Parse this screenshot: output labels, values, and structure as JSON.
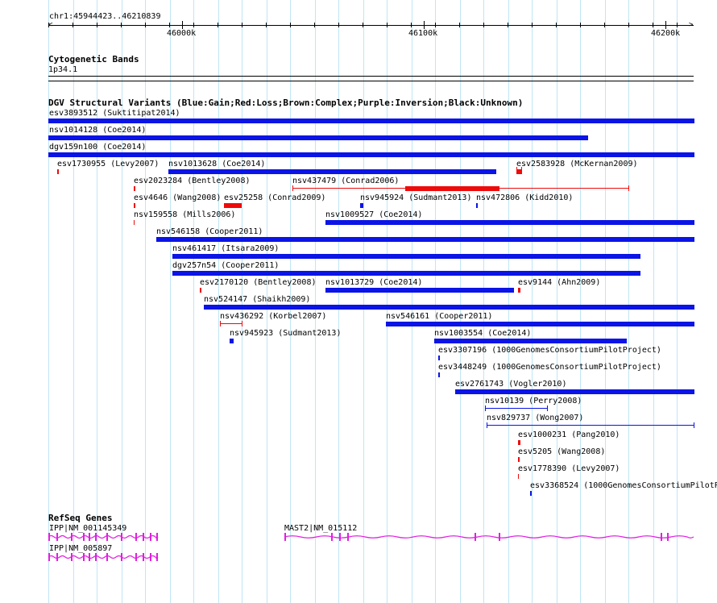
{
  "colors": {
    "gain": "#0b14e6",
    "loss": "#ee0b0b",
    "gene": "#e020e0",
    "grid": "#bfe6f5"
  },
  "ruler": {
    "locus": "chr1:45944423..46210839",
    "labels": [
      "46000k",
      "46100k",
      "46200k"
    ]
  },
  "cytoband": {
    "title": "Cytogenetic Bands",
    "band": "1p34.1"
  },
  "dgv": {
    "title": "DGV Structural Variants (Blue:Gain;Red:Loss;Brown:Complex;Purple:Inversion;Black:Unknown)",
    "features": [
      {
        "label": "esv3893512 (Suktitipat2014)",
        "type": "gain"
      },
      {
        "label": "nsv1014128 (Coe2014)",
        "type": "gain"
      },
      {
        "label": "dgv159n100 (Coe2014)",
        "type": "gain"
      },
      {
        "label": "esv1730955 (Levy2007)",
        "type": "loss"
      },
      {
        "label": "nsv1013628 (Coe2014)",
        "type": "gain"
      },
      {
        "label": "esv2583928 (McKernan2009)",
        "type": "loss"
      },
      {
        "label": "esv2023284 (Bentley2008)",
        "type": "loss"
      },
      {
        "label": "nsv437479 (Conrad2006)",
        "type": "loss"
      },
      {
        "label": "esv4646 (Wang2008)",
        "type": "loss"
      },
      {
        "label": "esv25258 (Conrad2009)",
        "type": "loss"
      },
      {
        "label": "nsv945924 (Sudmant2013)",
        "type": "gain"
      },
      {
        "label": "nsv472806 (Kidd2010)",
        "type": "gain"
      },
      {
        "label": "nsv159558 (Mills2006)",
        "type": "loss"
      },
      {
        "label": "nsv1009527 (Coe2014)",
        "type": "gain"
      },
      {
        "label": "nsv546158 (Cooper2011)",
        "type": "gain"
      },
      {
        "label": "nsv461417 (Itsara2009)",
        "type": "gain"
      },
      {
        "label": "dgv257n54 (Cooper2011)",
        "type": "gain"
      },
      {
        "label": "esv2170120 (Bentley2008)",
        "type": "loss"
      },
      {
        "label": "nsv1013729 (Coe2014)",
        "type": "gain"
      },
      {
        "label": "esv9144 (Ahn2009)",
        "type": "loss"
      },
      {
        "label": "nsv524147 (Shaikh2009)",
        "type": "gain"
      },
      {
        "label": "nsv436292 (Korbel2007)",
        "type": "loss"
      },
      {
        "label": "nsv546161 (Cooper2011)",
        "type": "gain"
      },
      {
        "label": "nsv945923 (Sudmant2013)",
        "type": "gain"
      },
      {
        "label": "nsv1003554 (Coe2014)",
        "type": "gain"
      },
      {
        "label": "esv3307196 (1000GenomesConsortiumPilotProject)",
        "type": "gain"
      },
      {
        "label": "esv3448249 (1000GenomesConsortiumPilotProject)",
        "type": "gain"
      },
      {
        "label": "esv2761743 (Vogler2010)",
        "type": "gain"
      },
      {
        "label": "nsv10139 (Perry2008)",
        "type": "gain"
      },
      {
        "label": "nsv829737 (Wong2007)",
        "type": "gain"
      },
      {
        "label": "esv1000231 (Pang2010)",
        "type": "loss"
      },
      {
        "label": "esv5205 (Wang2008)",
        "type": "loss"
      },
      {
        "label": "esv1778390 (Levy2007)",
        "type": "loss"
      },
      {
        "label": "esv3368524 (1000GenomesConsortiumPilotP",
        "type": "gain"
      }
    ]
  },
  "refseq": {
    "title": "RefSeq Genes",
    "genes": [
      {
        "label": "IPP|NM_001145349"
      },
      {
        "label": "IPP|NM_005897"
      },
      {
        "label": "MAST2|NM_015112"
      }
    ]
  }
}
